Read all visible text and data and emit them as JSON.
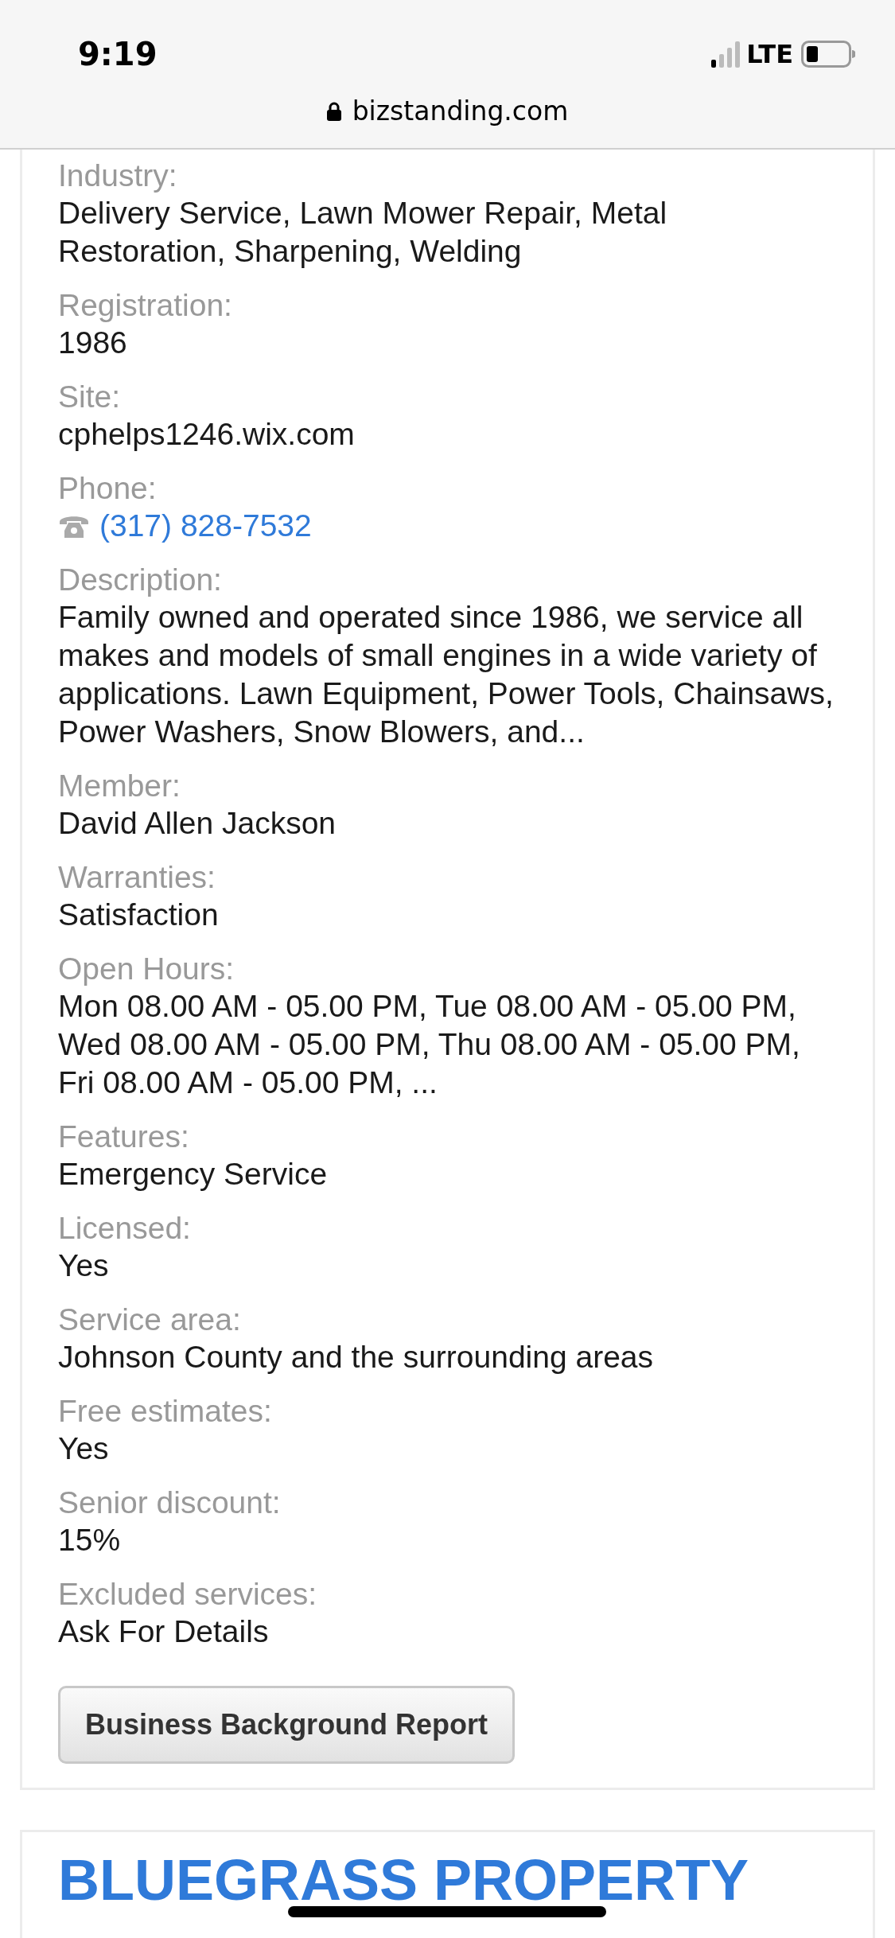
{
  "status_bar": {
    "time": "9:19",
    "network": "LTE"
  },
  "address_bar": {
    "url": "bizstanding.com"
  },
  "details": [
    {
      "label": "Industry:",
      "value": "Delivery Service, Lawn Mower Repair, Metal Restoration, Sharpening, Welding",
      "kind": "text"
    },
    {
      "label": "Registration:",
      "value": "1986",
      "kind": "text"
    },
    {
      "label": "Site:",
      "value": "cphelps1246.wix.com",
      "kind": "text"
    },
    {
      "label": "Phone:",
      "value": "(317) 828-7532",
      "kind": "phone"
    },
    {
      "label": "Description:",
      "value": "Family owned and operated since 1986, we service all makes and models of small engines in a wide variety of applications. Lawn Equipment, Power Tools, Chainsaws, Power Washers, Snow Blowers, and...",
      "kind": "text"
    },
    {
      "label": "Member:",
      "value": "David Allen Jackson",
      "kind": "text"
    },
    {
      "label": "Warranties:",
      "value": "Satisfaction",
      "kind": "text"
    },
    {
      "label": "Open Hours:",
      "value": "Mon 08.00 AM - 05.00 PM, Tue 08.00 AM - 05.00 PM, Wed 08.00 AM - 05.00 PM, Thu 08.00 AM - 05.00 PM, Fri 08.00 AM - 05.00 PM, ...",
      "kind": "text"
    },
    {
      "label": "Features:",
      "value": "Emergency Service",
      "kind": "text"
    },
    {
      "label": "Licensed:",
      "value": "Yes",
      "kind": "text"
    },
    {
      "label": "Service area:",
      "value": "Johnson County and the surrounding areas",
      "kind": "text"
    },
    {
      "label": "Free estimates:",
      "value": "Yes",
      "kind": "text"
    },
    {
      "label": "Senior discount:",
      "value": "15%",
      "kind": "text"
    },
    {
      "label": "Excluded services:",
      "value": "Ask For Details",
      "kind": "text"
    }
  ],
  "report_button": "Business Background Report",
  "next_card": {
    "title": "BLUEGRASS PROPERTY"
  }
}
